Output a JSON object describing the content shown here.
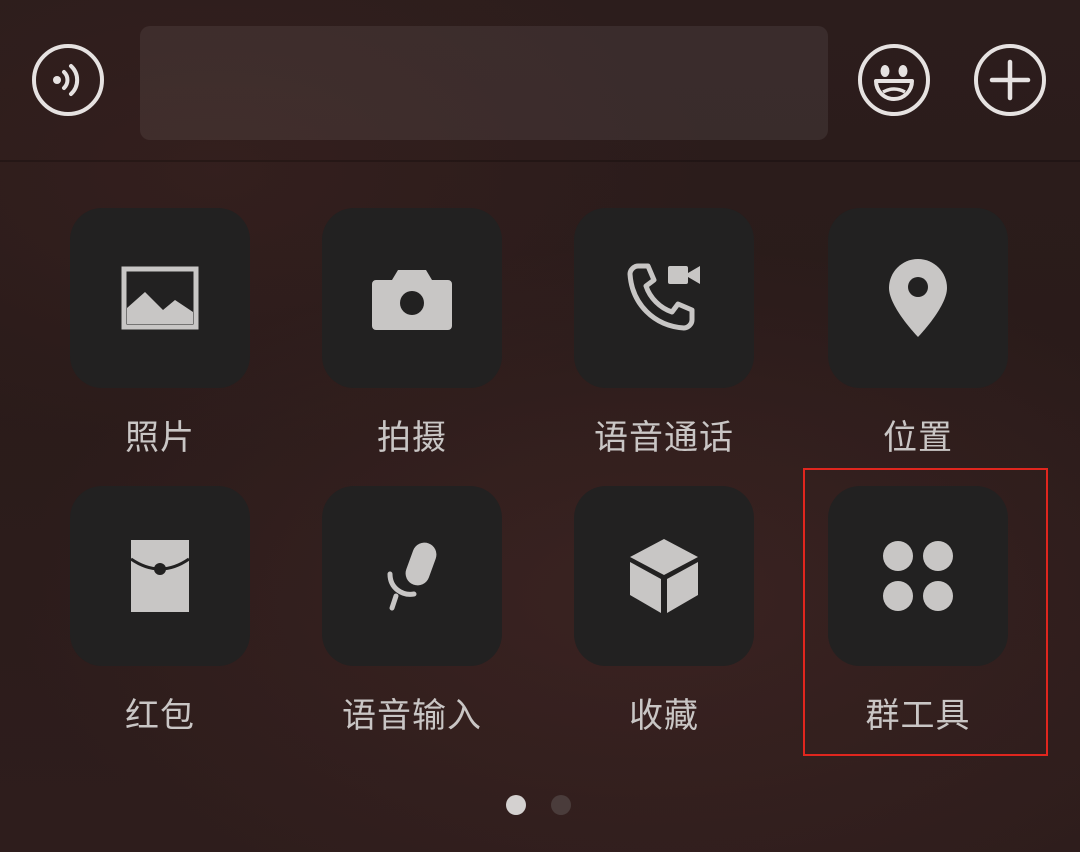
{
  "input_bar": {
    "text_value": "",
    "voice_icon": "voice-wave-icon",
    "emoji_icon": "smiley-face-icon",
    "plus_icon": "plus-icon"
  },
  "panel": {
    "items": [
      {
        "label": "照片",
        "icon": "photo-icon"
      },
      {
        "label": "拍摄",
        "icon": "camera-icon"
      },
      {
        "label": "语音通话",
        "icon": "voice-video-call-icon"
      },
      {
        "label": "位置",
        "icon": "location-pin-icon"
      },
      {
        "label": "红包",
        "icon": "red-packet-icon"
      },
      {
        "label": "语音输入",
        "icon": "microphone-icon"
      },
      {
        "label": "收藏",
        "icon": "favorites-cube-icon"
      },
      {
        "label": "群工具",
        "icon": "group-tools-icon"
      }
    ],
    "highlighted_item": "群工具"
  },
  "pager": {
    "pages": 2,
    "current_page": 1
  },
  "colors": {
    "background": "#2c1d1c",
    "tile": "#222121",
    "icon": "#c8c6c5",
    "label": "#c9c6c5",
    "outline_icon": "#e6e2e1",
    "highlight": "#e0261e",
    "dot_active": "#d4d1d0",
    "dot_inactive": "#4a3c3b"
  }
}
